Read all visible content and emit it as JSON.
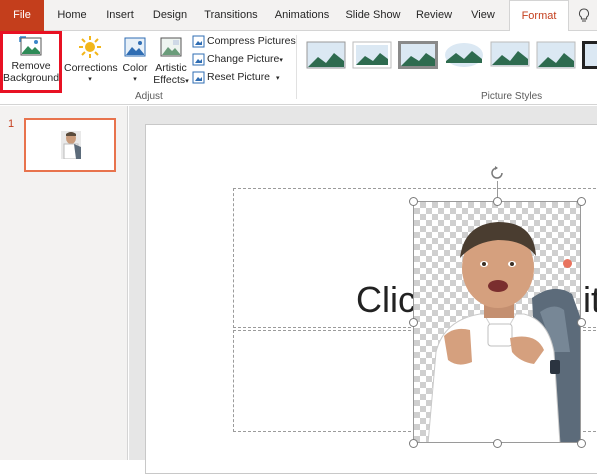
{
  "tabs": {
    "file": "File",
    "home": "Home",
    "insert": "Insert",
    "design": "Design",
    "transitions": "Transitions",
    "animations": "Animations",
    "slideshow": "Slide Show",
    "review": "Review",
    "view": "View",
    "format": "Format"
  },
  "ribbon": {
    "remove_bg_line1": "Remove",
    "remove_bg_line2": "Background",
    "corrections": "Corrections",
    "color": "Color",
    "artistic_line1": "Artistic",
    "artistic_line2": "Effects",
    "compress": "Compress Pictures",
    "change": "Change Picture",
    "reset": "Reset Picture",
    "group_adjust": "Adjust",
    "group_styles": "Picture Styles"
  },
  "thumbnails": {
    "slide_number": "1"
  },
  "slide": {
    "title_partial": "Clic",
    "title_tail": "it"
  },
  "colors": {
    "accent": "#c43e1c",
    "highlight": "#e81123"
  }
}
